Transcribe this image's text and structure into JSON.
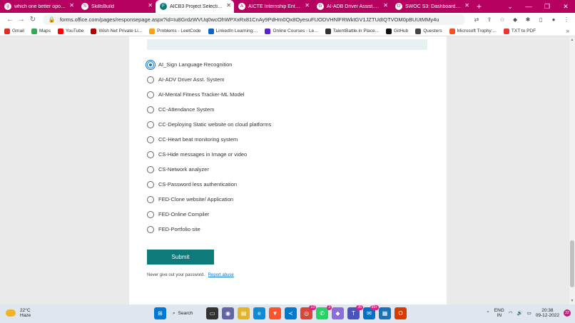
{
  "browser": {
    "tabs": [
      {
        "title": "which one better oportunit",
        "icon": "g",
        "color": "#ffffff",
        "active": false
      },
      {
        "title": "SkillsBuild",
        "icon": "S",
        "color": "#ffffff",
        "active": false
      },
      {
        "title": "AICB3 Project Selection",
        "icon": "F",
        "color": "#0e7a7a",
        "active": true
      },
      {
        "title": "AICTE Internship Enterprise",
        "icon": "A",
        "color": "#ffffff",
        "active": false
      },
      {
        "title": "AI-ADB Driver Assist. Syste",
        "icon": "G",
        "color": "#ffffff",
        "active": false
      },
      {
        "title": "SWOC S3: Dashboard | Dev",
        "icon": "D",
        "color": "#ffffff",
        "active": false
      }
    ],
    "new_tab": "+",
    "url": "forms.office.com/pages/responsepage.aspx?id=Iu8GrdzWVUq0wcOhWPXxRx81CnAy9PdHm0Qx8OyesuFUODVHNlFRWktGV1JZTUdIQTVOM0pBUUtMMy4u"
  },
  "bookmarks": [
    {
      "label": "Gmail",
      "color": "#d93025"
    },
    {
      "label": "Maps",
      "color": "#34a853"
    },
    {
      "label": "YouTube",
      "color": "#ff0000"
    },
    {
      "label": "Wish Net Private Li...",
      "color": "#b30000"
    },
    {
      "label": "Problems - LeetCode",
      "color": "#f89f1b"
    },
    {
      "label": "LinkedIn Learning:...",
      "color": "#0a66c2"
    },
    {
      "label": "Online Courses - Le...",
      "color": "#5624d0"
    },
    {
      "label": "TalentBattle.in Place...",
      "color": "#333333"
    },
    {
      "label": "GitHub",
      "color": "#111111"
    },
    {
      "label": "Questers",
      "color": "#444444"
    },
    {
      "label": "Microsoft Trophy:...",
      "color": "#f25022"
    },
    {
      "label": "TXT to PDF",
      "color": "#e53935"
    }
  ],
  "form": {
    "options": [
      {
        "label": "AI_Sign Language Recognition",
        "checked": true
      },
      {
        "label": "AI-ADV Driver Asst. System",
        "checked": false
      },
      {
        "label": "AI-Mental Fitness Tracker-ML Model",
        "checked": false
      },
      {
        "label": "CC-Attendance System",
        "checked": false
      },
      {
        "label": "CC-Deploying Static website on cloud platforms",
        "checked": false
      },
      {
        "label": "CC-Heart beat monitoring system",
        "checked": false
      },
      {
        "label": "CS-Hide messages in Image or video",
        "checked": false
      },
      {
        "label": "CS-Network analyzer",
        "checked": false
      },
      {
        "label": "CS-Password less authentication",
        "checked": false
      },
      {
        "label": "FED-Clone website/ Application",
        "checked": false
      },
      {
        "label": "FED-Online Compiler",
        "checked": false
      },
      {
        "label": "FED-Portfolio site",
        "checked": false
      }
    ],
    "submit_label": "Submit",
    "footer_text": "Never give out your password.",
    "report_link": "Report abuse"
  },
  "taskbar": {
    "weather_temp": "22°C",
    "weather_desc": "Haze",
    "search_label": "Search",
    "badges": {
      "chrome": "13",
      "whatsapp": "3",
      "teams": "35",
      "mail": "99+"
    },
    "lang_line1": "ENG",
    "lang_line2": "IN",
    "time": "20:38",
    "date": "09-12-2022",
    "notifications": "22"
  }
}
